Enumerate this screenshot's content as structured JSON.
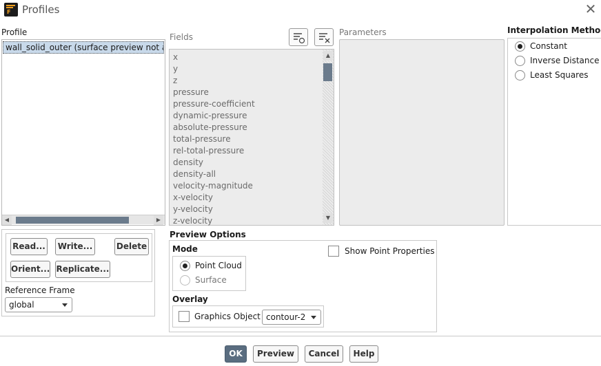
{
  "window": {
    "title": "Profiles",
    "icon": "fluent-app-icon",
    "close_glyph": "✕"
  },
  "profile": {
    "label": "Profile",
    "items": [
      "wall_solid_outer (surface preview not available)"
    ],
    "selected_index": 0
  },
  "fields": {
    "label": "Fields",
    "items": [
      "x",
      "y",
      "z",
      "pressure",
      "pressure-coefficient",
      "dynamic-pressure",
      "absolute-pressure",
      "total-pressure",
      "rel-total-pressure",
      "density",
      "density-all",
      "velocity-magnitude",
      "x-velocity",
      "y-velocity",
      "z-velocity"
    ],
    "select_all_icon": "select-all-list-icon",
    "deselect_all_icon": "deselect-all-list-icon"
  },
  "parameters": {
    "label": "Parameters"
  },
  "interpolation": {
    "label": "Interpolation Method",
    "options": [
      "Constant",
      "Inverse Distance",
      "Least Squares"
    ],
    "selected": "Constant"
  },
  "profile_buttons": {
    "read": "Read...",
    "write": "Write...",
    "delete": "Delete",
    "orient": "Orient...",
    "replicate": "Replicate..."
  },
  "reference_frame": {
    "label": "Reference Frame",
    "value": "global"
  },
  "preview_options": {
    "label": "Preview Options",
    "mode_label": "Mode",
    "mode_options": [
      "Point Cloud",
      "Surface"
    ],
    "mode_selected": "Point Cloud",
    "show_point_properties": "Show Point Properties",
    "show_point_properties_checked": false,
    "overlay_label": "Overlay",
    "graphics_object_label": "Graphics Object",
    "graphics_object_checked": false,
    "graphics_object_value": "contour-2"
  },
  "footer": {
    "ok": "OK",
    "preview": "Preview",
    "cancel": "Cancel",
    "help": "Help"
  }
}
